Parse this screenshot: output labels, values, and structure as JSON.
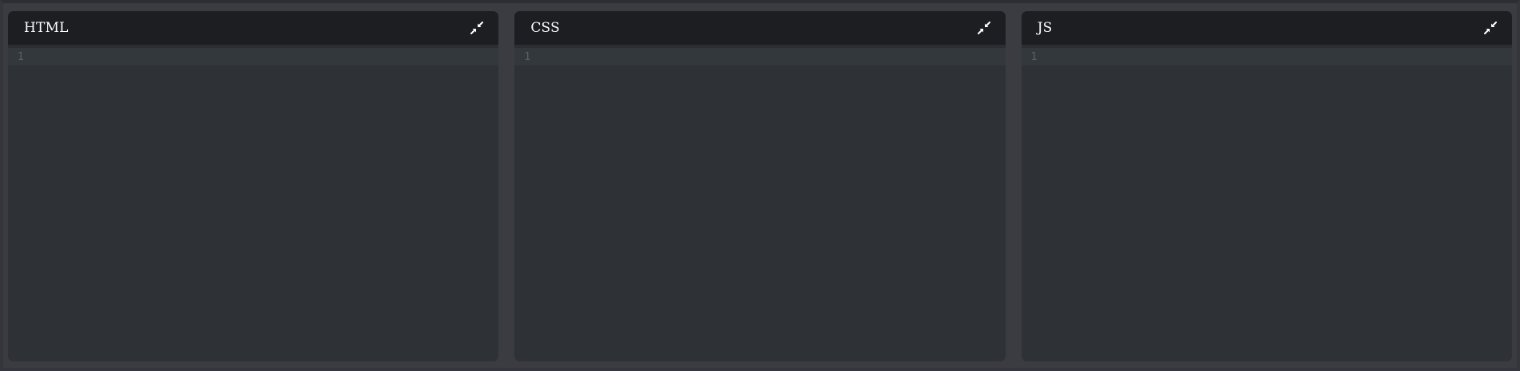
{
  "editors": [
    {
      "title": "HTML",
      "lines": [
        "1"
      ],
      "content": "",
      "collapse_icon": "compress-arrows-icon"
    },
    {
      "title": "CSS",
      "lines": [
        "1"
      ],
      "content": "",
      "collapse_icon": "compress-arrows-icon"
    },
    {
      "title": "JS",
      "lines": [
        "1"
      ],
      "content": "",
      "collapse_icon": "compress-arrows-icon"
    }
  ],
  "colors": {
    "page_background": "#3a3c42",
    "header_background": "#1d1e22",
    "editor_background": "#2e3135",
    "active_line_background": "#33383c",
    "line_number_color": "#5b6168",
    "title_color": "#ffffff"
  }
}
